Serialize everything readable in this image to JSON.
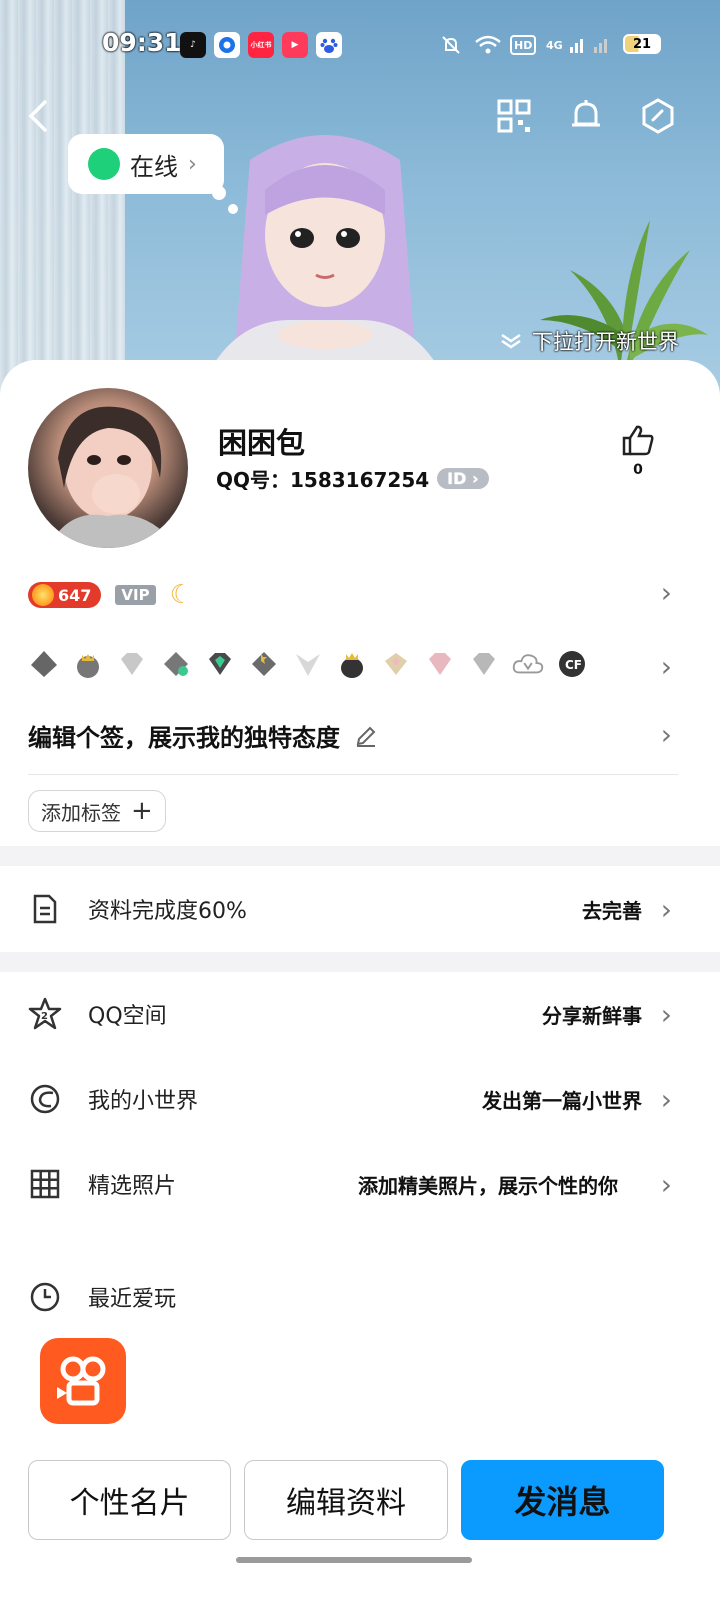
{
  "status_bar": {
    "time": "09:31",
    "apps": [
      "tiktok-icon",
      "browser-icon",
      "xiaohongshu-icon",
      "video-icon",
      "baidu-icon"
    ],
    "xiaohongshu_label": "小红书",
    "network_hd": "HD",
    "network_4g": "4G",
    "battery": "21"
  },
  "hero": {
    "online_status": "在线",
    "pull_hint": "下拉打开新世界"
  },
  "profile": {
    "nickname": "困困包",
    "qq_label": "QQ号：1583167254",
    "id_badge": "ID",
    "like_count": "0",
    "level": "647",
    "vip": "VIP",
    "signature": "编辑个签，展示我的独特态度",
    "add_tag": "添加标签"
  },
  "rows": {
    "completeness": {
      "label": "资料完成度60%",
      "hint": "去完善"
    },
    "qzone": {
      "label": "QQ空间",
      "hint": "分享新鲜事"
    },
    "small_world": {
      "label": "我的小世界",
      "hint": "发出第一篇小世界"
    },
    "photos": {
      "label": "精选照片",
      "hint": "添加精美照片，展示个性的你"
    },
    "recent_play": {
      "label": "最近爱玩"
    }
  },
  "bottom_buttons": {
    "card": "个性名片",
    "edit": "编辑资料",
    "message": "发消息"
  },
  "colors": {
    "accent": "#0b9bff",
    "online": "#1fd07a",
    "app_tile": "#ff5a1f"
  }
}
